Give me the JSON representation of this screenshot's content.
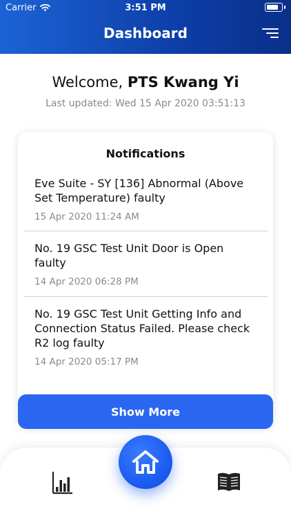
{
  "status_bar": {
    "carrier": "Carrier",
    "time": "3:51 PM"
  },
  "header": {
    "title": "Dashboard"
  },
  "welcome": {
    "greeting": "Welcome,",
    "name": "PTS Kwang Yi"
  },
  "last_updated": "Last updated: Wed 15 Apr 2020 03:51:13",
  "notifications": {
    "title": "Notifications",
    "items": [
      {
        "text": "Eve Suite - SY [136] Abnormal (Above Set Temperature) faulty",
        "time": "15 Apr 2020 11:24 AM"
      },
      {
        "text": "No. 19 GSC Test Unit Door is Open faulty",
        "time": "14 Apr 2020 06:28 PM"
      },
      {
        "text": "No. 19 GSC Test Unit Getting Info and Connection Status Failed. Please check R2 log faulty",
        "time": "14 Apr 2020 05:17 PM"
      }
    ]
  },
  "show_more_label": "Show More",
  "bottom_nav": {
    "left_icon": "bar-chart-icon",
    "center_icon": "home-icon",
    "right_icon": "book-icon"
  },
  "colors": {
    "primary": "#2a66f0",
    "header_start": "#1c63d6",
    "header_end": "#0a2f8a"
  }
}
